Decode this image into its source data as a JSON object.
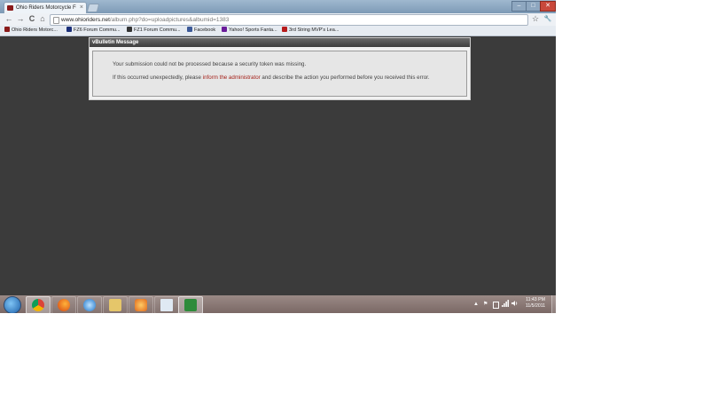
{
  "browser": {
    "tab_title": "Ohio Riders Motorcycle Fo",
    "tab_close": "×",
    "window_buttons": {
      "minimize": "–",
      "maximize": "□",
      "close": "✕"
    },
    "nav": {
      "back": "←",
      "forward": "→",
      "reload": "C",
      "home": "⌂"
    },
    "url": {
      "host": "www.ohioriders.net",
      "path": "/album.php?do=uploadpictures&albumid=1383"
    },
    "star_icon": "☆",
    "wrench_icon": "🔧",
    "bookmarks": [
      {
        "label": "Ohio Riders Motorc...",
        "icon_color": "#8a1a1a"
      },
      {
        "label": "FZ6 Forum Commu...",
        "icon_color": "#1b2f7a"
      },
      {
        "label": "FZ1 Forum Commu...",
        "icon_color": "#333333"
      },
      {
        "label": "Facebook",
        "icon_color": "#3b5998"
      },
      {
        "label": "Yahoo! Sports Fanta...",
        "icon_color": "#6a1b9a"
      },
      {
        "label": "3rd String MVP's Lea...",
        "icon_color": "#b71c1c"
      }
    ]
  },
  "dialog": {
    "header": "vBulletin Message",
    "message1": "Your submission could not be processed because a security token was missing.",
    "message2_before": "If this occurred unexpectedly, please ",
    "message2_link": "inform the administrator",
    "message2_after": " and describe the action you performed before you received this error."
  },
  "taskbar": {
    "apps": [
      "chrome",
      "firefox",
      "internet-explorer",
      "file-explorer",
      "media-player",
      "notepad",
      "excel"
    ],
    "tray": {
      "show_hidden": "▲",
      "flag": "⚑"
    },
    "clock": {
      "time": "11:43 PM",
      "date": "11/5/2011"
    }
  }
}
